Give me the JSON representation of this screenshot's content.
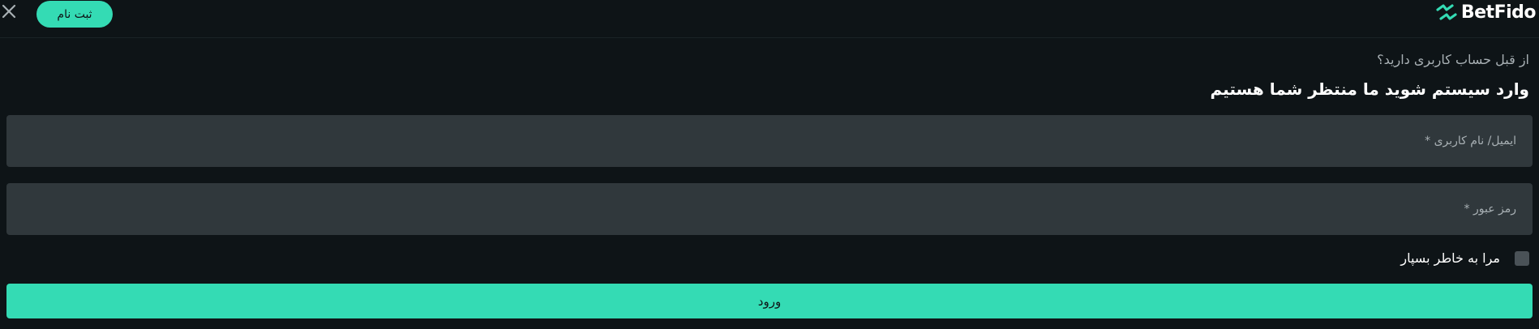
{
  "header": {
    "signup_label": "ثبت نام",
    "logo_text": "BetFido",
    "close_icon": "close-icon",
    "logo_icon": "betfido-logo-icon"
  },
  "form": {
    "subheading": "از قبل حساب کاربری دارید؟",
    "heading": "وارد سیستم شوید ما منتظر شما هستیم",
    "email": {
      "placeholder": "ایمیل/ نام کاربری *",
      "value": ""
    },
    "password": {
      "placeholder": "رمز عبور *",
      "value": ""
    },
    "remember_label": "مرا به خاطر بسپار",
    "remember_checked": false,
    "login_label": "ورود"
  },
  "colors": {
    "background": "#0e1417",
    "accent": "#34dbb4",
    "field": "#30383c",
    "muted_text": "#a8b0b4"
  }
}
